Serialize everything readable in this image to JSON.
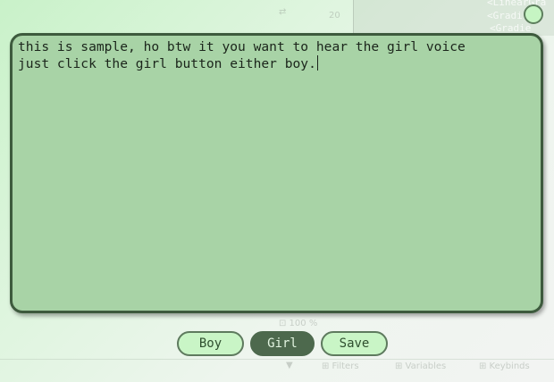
{
  "editor": {
    "text": "this is sample, ho btw it you want to hear the girl voice\njust click the girl button either boy."
  },
  "buttons": {
    "boy_label": "Boy",
    "girl_label": "Girl",
    "save_label": "Save",
    "selected": "Girl"
  },
  "colors": {
    "panel_fill": "#a8d3a6",
    "panel_border": "#3d5a3d",
    "button_light": "#c9f5c6",
    "button_dark": "#4d694d",
    "accent_circle": "#c6f5c3"
  }
}
